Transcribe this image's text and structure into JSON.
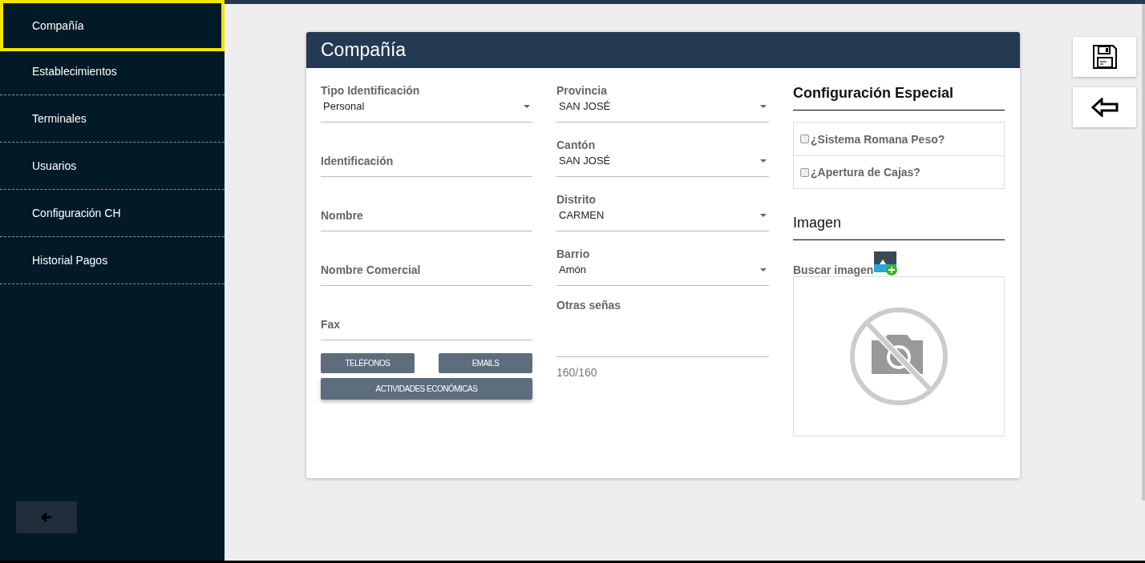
{
  "sidebar": {
    "items": [
      {
        "label": "Compañía",
        "selected": true
      },
      {
        "label": "Establecimientos",
        "selected": false
      },
      {
        "label": "Terminales",
        "selected": false
      },
      {
        "label": "Usuarios",
        "selected": false
      },
      {
        "label": "Configuración CH",
        "selected": false
      },
      {
        "label": "Historial Pagos",
        "selected": false
      }
    ]
  },
  "card": {
    "title": "Compañía",
    "column_1": {
      "fields": [
        {
          "kind": "select",
          "label": "Tipo Identificación",
          "value": "Personal"
        },
        {
          "kind": "text",
          "label": "Identificación"
        },
        {
          "kind": "text",
          "label": "Nombre"
        },
        {
          "kind": "text",
          "label": "Nombre Comercial"
        },
        {
          "kind": "text",
          "label": "Fax"
        }
      ],
      "buttons": [
        "TELÉFONOS",
        "EMAILS"
      ],
      "wide_button": "ACTIVIDADES ECONÓMICAS"
    },
    "column_2": {
      "fields": [
        {
          "kind": "select",
          "label": "Provincia",
          "value": "SAN JOSÉ"
        },
        {
          "kind": "select",
          "label": "Cantón",
          "value": "SAN JOSÉ"
        },
        {
          "kind": "select",
          "label": "Distrito",
          "value": "CARMEN"
        },
        {
          "kind": "select",
          "label": "Barrio",
          "value": "Amón"
        },
        {
          "kind": "textarea",
          "label": "Otras señas",
          "counter": "160/160"
        }
      ]
    },
    "column_3": {
      "special_title": "Configuración Especial",
      "options": [
        {
          "label": "¿Sistema Romana Peso?",
          "checked": false
        },
        {
          "label": "¿Apertura de Cajas?",
          "checked": false
        }
      ],
      "image_title": "Imagen",
      "image_label": "Buscar imagen"
    }
  }
}
